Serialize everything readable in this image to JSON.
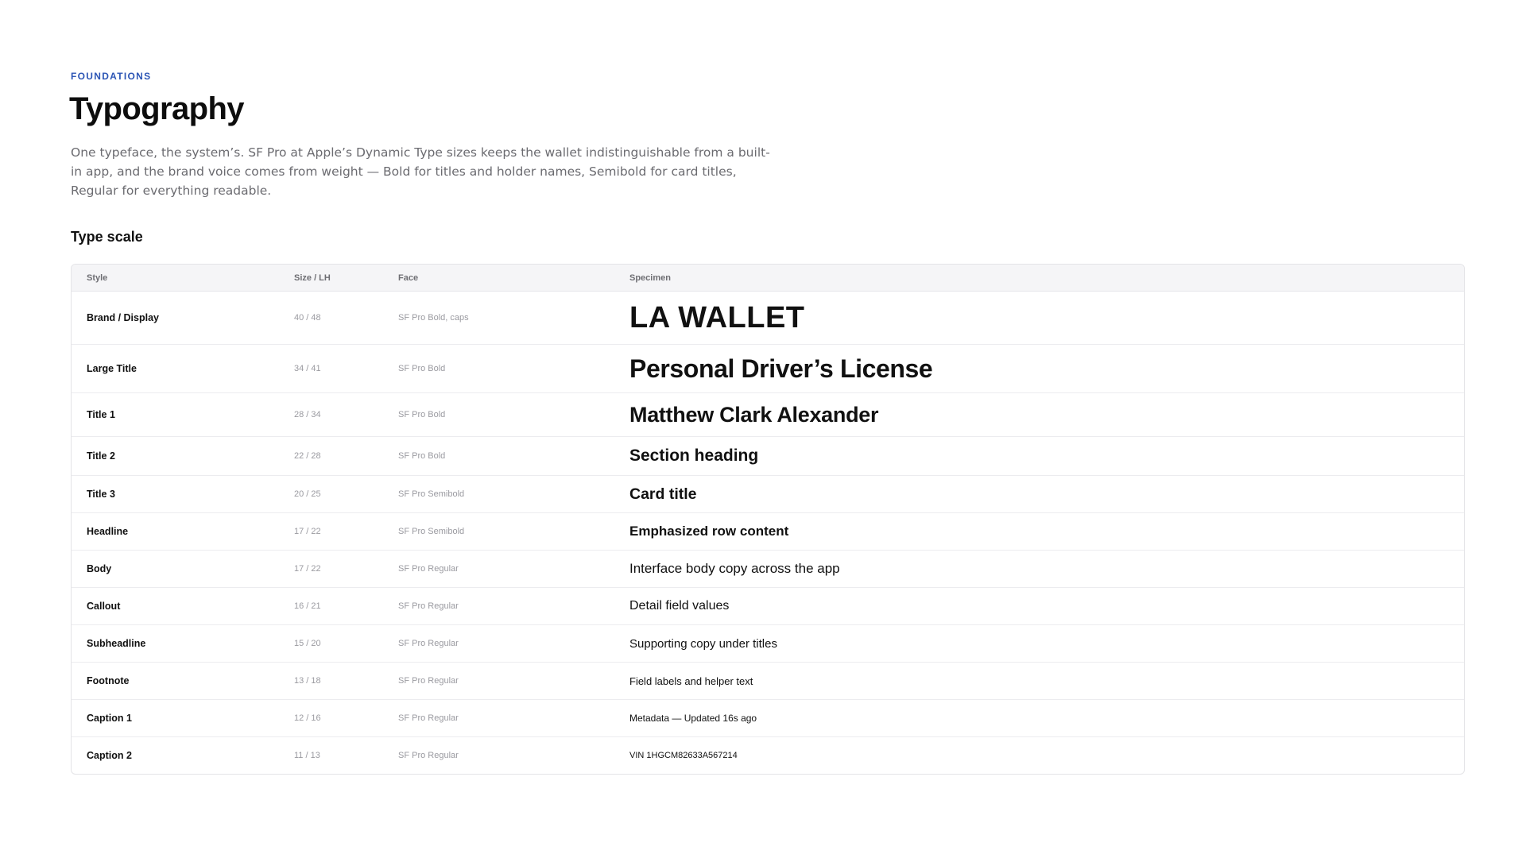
{
  "header": {
    "eyebrow": "FOUNDATIONS",
    "title": "Typography",
    "intro": "One typeface, the system’s. SF Pro at Apple’s Dynamic Type sizes keeps the wallet indistinguishable from a built-in app, and the brand voice comes from weight — Bold for titles and holder names, Semibold for card titles, Regular for everything readable."
  },
  "type_scale": {
    "title": "Type scale",
    "columns": {
      "style": "Style",
      "size": "Size / LH",
      "face": "Face",
      "specimen": "Specimen"
    },
    "rows": [
      {
        "style": "Brand / Display",
        "size": "40 / 48",
        "face": "SF Pro Bold, caps",
        "specimen": "LA WALLET"
      },
      {
        "style": "Large Title",
        "size": "34 / 41",
        "face": "SF Pro Bold",
        "specimen": "Personal Driver’s License"
      },
      {
        "style": "Title 1",
        "size": "28 / 34",
        "face": "SF Pro Bold",
        "specimen": "Matthew Clark Alexander"
      },
      {
        "style": "Title 2",
        "size": "22 / 28",
        "face": "SF Pro Bold",
        "specimen": "Section heading"
      },
      {
        "style": "Title 3",
        "size": "20 / 25",
        "face": "SF Pro Semibold",
        "specimen": "Card title"
      },
      {
        "style": "Headline",
        "size": "17 / 22",
        "face": "SF Pro Semibold",
        "specimen": "Emphasized row content"
      },
      {
        "style": "Body",
        "size": "17 / 22",
        "face": "SF Pro Regular",
        "specimen": "Interface body copy across the app"
      },
      {
        "style": "Callout",
        "size": "16 / 21",
        "face": "SF Pro Regular",
        "specimen": "Detail field values"
      },
      {
        "style": "Subheadline",
        "size": "15 / 20",
        "face": "SF Pro Regular",
        "specimen": "Supporting copy under titles"
      },
      {
        "style": "Footnote",
        "size": "13 / 18",
        "face": "SF Pro Regular",
        "specimen": "Field labels and helper text"
      },
      {
        "style": "Caption 1",
        "size": "12 / 16",
        "face": "SF Pro Regular",
        "specimen": "Metadata — Updated 16s ago"
      },
      {
        "style": "Caption 2",
        "size": "11 / 13",
        "face": "SF Pro Regular",
        "specimen": "VIN 1HGCM82633A567214"
      }
    ]
  }
}
